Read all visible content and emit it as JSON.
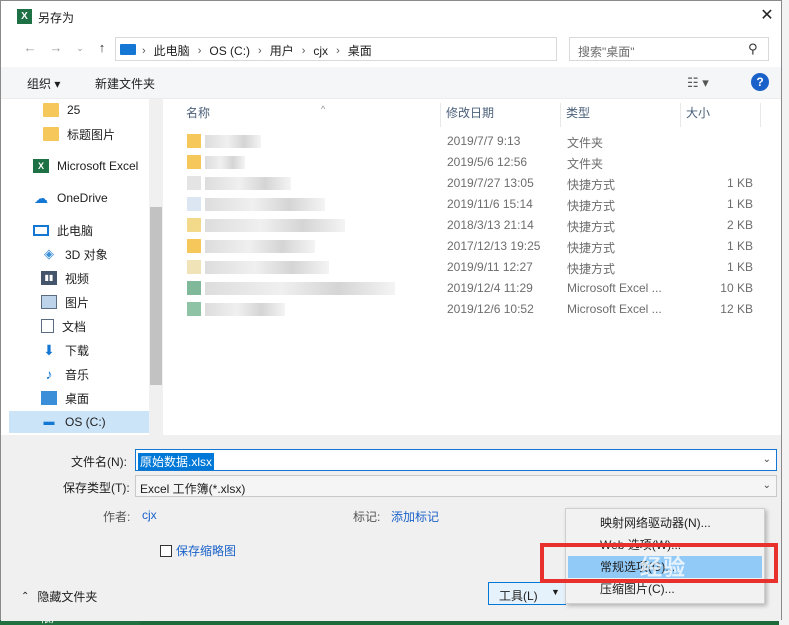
{
  "window": {
    "title": "另存为",
    "app_icon": "X"
  },
  "address": {
    "crumbs": [
      "此电脑",
      "OS (C:)",
      "用户",
      "cjx",
      "桌面"
    ]
  },
  "search": {
    "placeholder": "搜索\"桌面\""
  },
  "toolbar": {
    "organize": "组织 ▾",
    "new_folder": "新建文件夹",
    "help": "?"
  },
  "sidebar": {
    "items": [
      {
        "label": "25",
        "icon": "folder-icon"
      },
      {
        "label": "标题图片",
        "icon": "folder-icon"
      },
      {
        "label": "Microsoft Excel",
        "icon": "excel-icon"
      },
      {
        "label": "OneDrive",
        "icon": "cloud-icon"
      },
      {
        "label": "此电脑",
        "icon": "computer-icon"
      },
      {
        "label": "3D 对象",
        "icon": "3d-objects-icon"
      },
      {
        "label": "视频",
        "icon": "video-icon"
      },
      {
        "label": "图片",
        "icon": "pictures-icon"
      },
      {
        "label": "文档",
        "icon": "documents-icon"
      },
      {
        "label": "下载",
        "icon": "download-icon"
      },
      {
        "label": "音乐",
        "icon": "music-icon"
      },
      {
        "label": "桌面",
        "icon": "desktop-icon"
      },
      {
        "label": "OS (C:)",
        "icon": "drive-icon"
      }
    ]
  },
  "columns": {
    "name": "名称",
    "date": "修改日期",
    "type": "类型",
    "size": "大小"
  },
  "files": [
    {
      "date": "2019/7/7 9:13",
      "type": "文件夹",
      "size": ""
    },
    {
      "date": "2019/5/6 12:56",
      "type": "文件夹",
      "size": ""
    },
    {
      "date": "2019/7/27 13:05",
      "type": "快捷方式",
      "size": "1 KB"
    },
    {
      "date": "2019/11/6 15:14",
      "type": "快捷方式",
      "size": "1 KB"
    },
    {
      "date": "2018/3/13 21:14",
      "type": "快捷方式",
      "size": "2 KB"
    },
    {
      "date": "2017/12/13 19:25",
      "type": "快捷方式",
      "size": "1 KB"
    },
    {
      "date": "2019/9/11 12:27",
      "type": "快捷方式",
      "size": "1 KB"
    },
    {
      "date": "2019/12/4 11:29",
      "type": "Microsoft Excel ...",
      "size": "10 KB"
    },
    {
      "date": "2019/12/6 10:52",
      "type": "Microsoft Excel ...",
      "size": "12 KB"
    }
  ],
  "form": {
    "filename_label": "文件名(N):",
    "filename_value": "原始数据.xlsx",
    "filetype_label": "保存类型(T):",
    "filetype_value": "Excel 工作簿(*.xlsx)",
    "author_label": "作者:",
    "author_value": "cjx",
    "tags_label": "标记:",
    "tags_value": "添加标记",
    "thumbnail_label": "保存缩略图",
    "hide_folders": "隐藏文件夹",
    "tools_button": "工具(L)"
  },
  "tools_menu": [
    "映射网络驱动器(N)...",
    "Web 选项(W)...",
    "常规选项(G)...",
    "压缩图片(C)..."
  ],
  "background": {
    "taskbar_text": "帐户"
  },
  "watermark": "经验"
}
